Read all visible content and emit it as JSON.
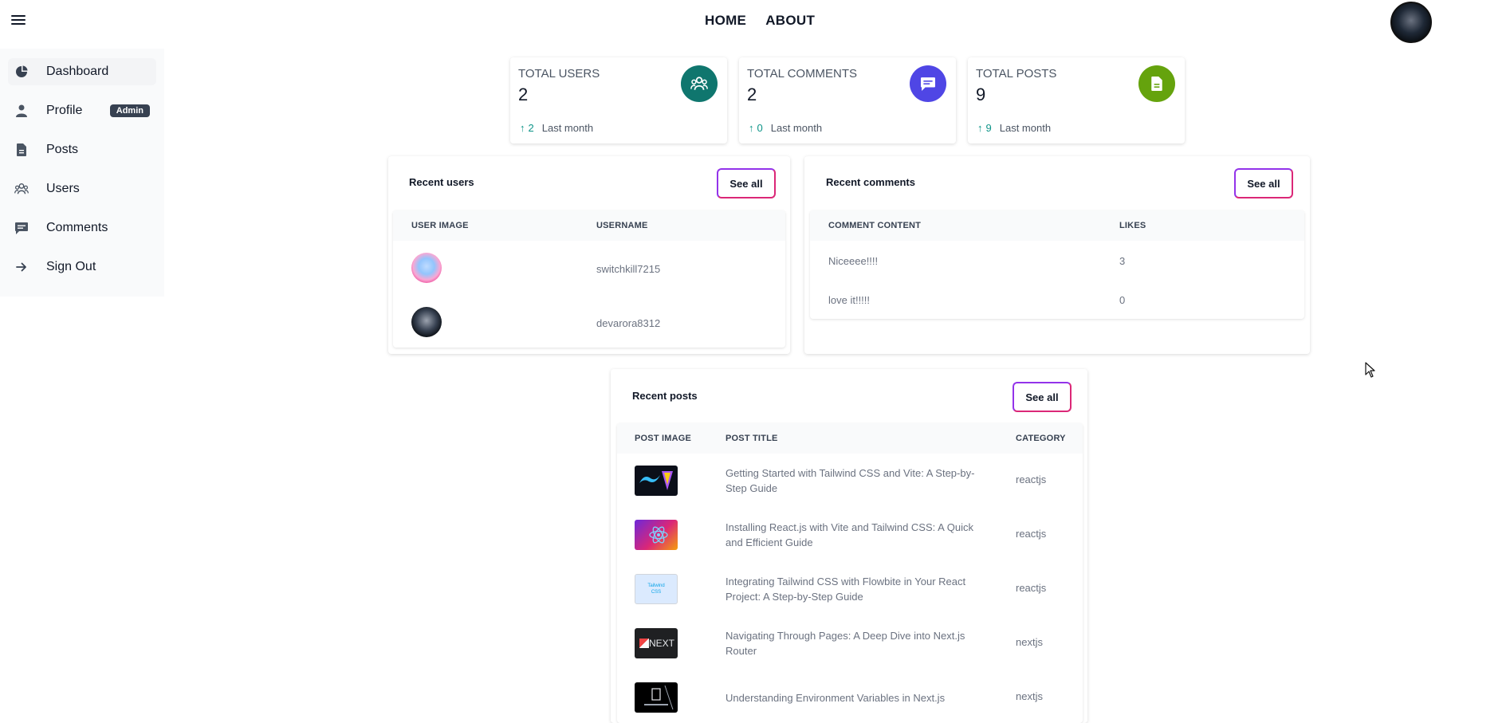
{
  "header": {
    "nav": [
      {
        "label": "HOME"
      },
      {
        "label": "ABOUT"
      }
    ]
  },
  "sidebar": {
    "items": [
      {
        "label": "Dashboard",
        "icon": "pie-chart-icon"
      },
      {
        "label": "Profile",
        "icon": "user-icon",
        "badge": "Admin"
      },
      {
        "label": "Posts",
        "icon": "document-icon"
      },
      {
        "label": "Users",
        "icon": "users-icon"
      },
      {
        "label": "Comments",
        "icon": "chat-icon"
      },
      {
        "label": "Sign Out",
        "icon": "arrow-right-icon"
      }
    ]
  },
  "stats": [
    {
      "title": "TOTAL USERS",
      "value": "2",
      "delta": "2",
      "period": "Last month",
      "icon": "users-group-icon",
      "color": "#0f766e"
    },
    {
      "title": "TOTAL COMMENTS",
      "value": "2",
      "delta": "0",
      "period": "Last month",
      "icon": "chat-icon",
      "color": "#4f46e5"
    },
    {
      "title": "TOTAL POSTS",
      "value": "9",
      "delta": "9",
      "period": "Last month",
      "icon": "document-icon",
      "color": "#65a30d"
    }
  ],
  "recent_users": {
    "title": "Recent users",
    "see_all": "See all",
    "headers": [
      "USER IMAGE",
      "USERNAME"
    ],
    "rows": [
      {
        "username": "switchkill7215"
      },
      {
        "username": "devarora8312"
      }
    ]
  },
  "recent_comments": {
    "title": "Recent comments",
    "see_all": "See all",
    "headers": [
      "COMMENT CONTENT",
      "LIKES"
    ],
    "rows": [
      {
        "content": "Niceeee!!!!",
        "likes": "3"
      },
      {
        "content": "love it!!!!!",
        "likes": "0"
      }
    ]
  },
  "recent_posts": {
    "title": "Recent posts",
    "see_all": "See all",
    "headers": [
      "POST IMAGE",
      "POST TITLE",
      "CATEGORY"
    ],
    "rows": [
      {
        "title_line1": "Getting Started with Tailwind CSS and Vite: A Step-by-",
        "title_line2": "Step Guide",
        "category": "reactjs"
      },
      {
        "title_line1": "Installing React.js with Vite and Tailwind CSS: A Quick",
        "title_line2": "and Efficient Guide",
        "category": "reactjs"
      },
      {
        "title_line1": "Integrating Tailwind CSS with Flowbite in Your React",
        "title_line2": "Project: A Step-by-Step Guide",
        "category": "reactjs",
        "thumb_text": "Tailwind CSS"
      },
      {
        "title_line1": "Navigating Through Pages: A Deep Dive into Next.js",
        "title_line2": "Router",
        "category": "nextjs",
        "thumb_text": "NEXT"
      },
      {
        "title_line1": "Understanding Environment Variables in Next.js",
        "title_line2": "",
        "category": "nextjs"
      }
    ]
  }
}
